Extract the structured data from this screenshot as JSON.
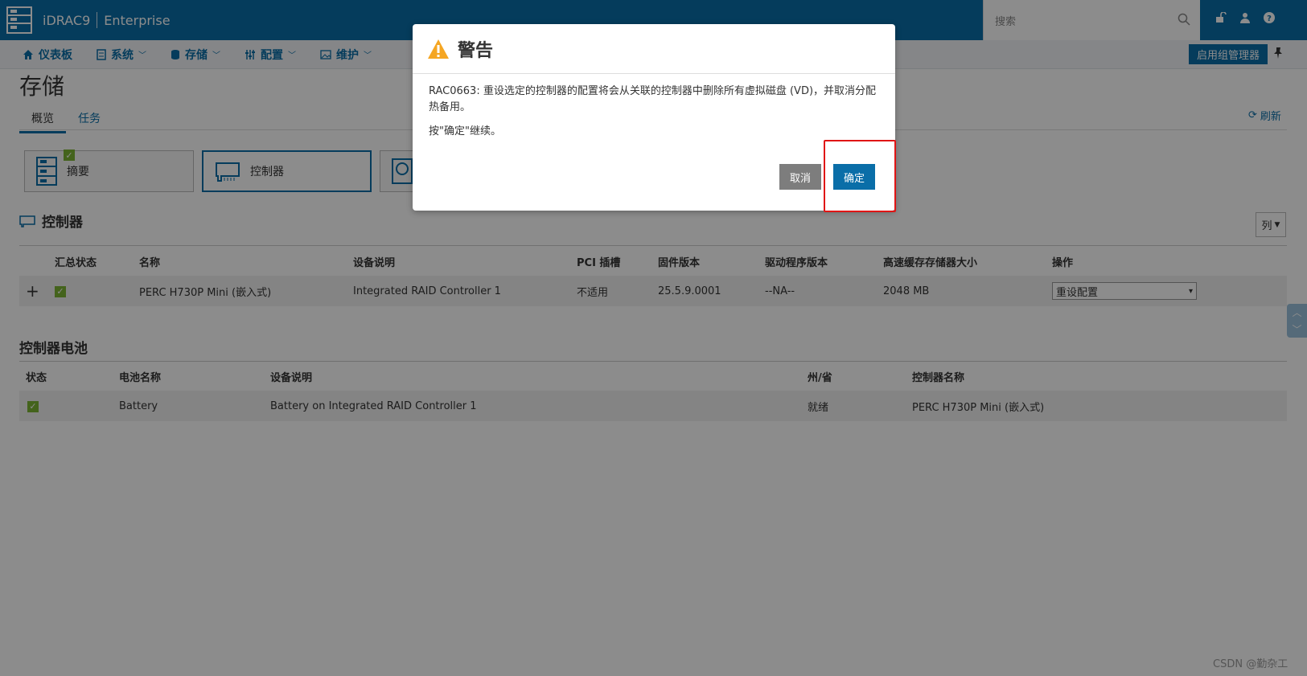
{
  "header": {
    "brand": "iDRAC9",
    "edition": "Enterprise",
    "search_placeholder": "搜索"
  },
  "nav": {
    "items": [
      {
        "label": "仪表板"
      },
      {
        "label": "系统"
      },
      {
        "label": "存储"
      },
      {
        "label": "配置"
      },
      {
        "label": "维护"
      }
    ],
    "group_manager": "启用组管理器"
  },
  "page": {
    "title": "存储",
    "tabs": [
      "概览",
      "任务"
    ],
    "refresh": "刷新"
  },
  "cards": [
    {
      "label": "摘要"
    },
    {
      "label": "控制器"
    }
  ],
  "controllers": {
    "title": "控制器",
    "columns_button": "列",
    "headers": [
      "汇总状态",
      "名称",
      "设备说明",
      "PCI 插槽",
      "固件版本",
      "驱动程序版本",
      "高速缓存存储器大小",
      "操作"
    ],
    "rows": [
      {
        "expand": "+",
        "name": "PERC H730P Mini (嵌入式)",
        "description": "Integrated RAID Controller 1",
        "pci_slot": "不适用",
        "firmware": "25.5.9.0001",
        "driver": "--NA--",
        "cache": "2048 MB",
        "action": "重设配置"
      }
    ]
  },
  "battery": {
    "title": "控制器电池",
    "headers": [
      "状态",
      "电池名称",
      "设备说明",
      "州/省",
      "控制器名称"
    ],
    "rows": [
      {
        "name": "Battery",
        "description": "Battery on Integrated RAID Controller 1",
        "state": "就绪",
        "controller": "PERC H730P Mini (嵌入式)"
      }
    ]
  },
  "dialog": {
    "title": "警告",
    "message": "RAC0663: 重设选定的控制器的配置将会从关联的控制器中删除所有虚拟磁盘 (VD)，并取消分配热备用。",
    "instruction": "按\"确定\"继续。",
    "cancel": "取消",
    "ok": "确定"
  },
  "watermark": "CSDN @勤杂工",
  "colors": {
    "brand_blue": "#0a6ea8",
    "status_green": "#7cb534",
    "highlight_red": "#e01515"
  }
}
